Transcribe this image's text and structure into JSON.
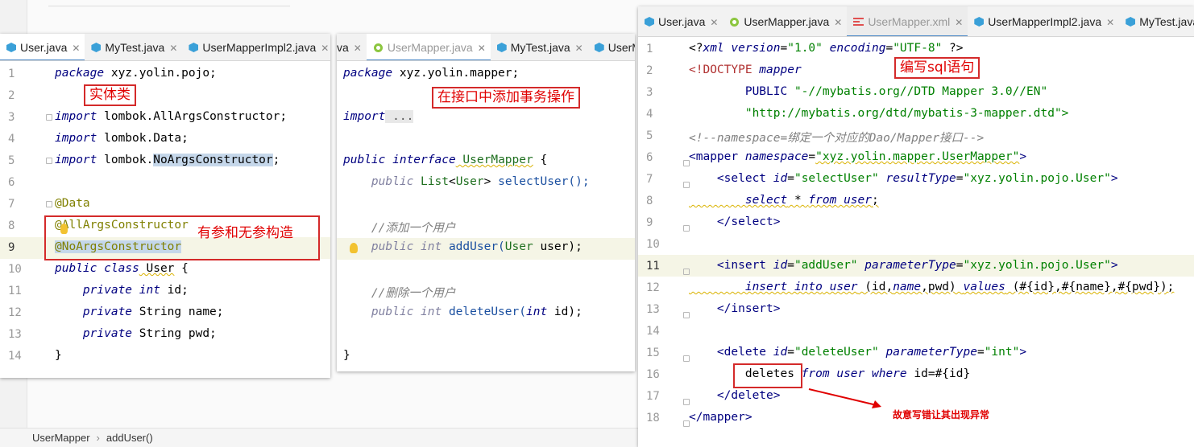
{
  "statusbar": {
    "crumb1": "UserMapper",
    "crumb2": "addUser()"
  },
  "panel1": {
    "tabs": [
      "User.java",
      "MyTest.java",
      "UserMapperImpl2.java"
    ],
    "lines": [
      "1",
      "2",
      "3",
      "4",
      "5",
      "6",
      "7",
      "8",
      "9",
      "10",
      "11",
      "12",
      "13",
      "14"
    ],
    "code": {
      "l1a": "package",
      "l1b": " xyz.yolin.pojo;",
      "l3a": "import",
      "l3b": " lombok.AllArgsConstructor;",
      "l4a": "import",
      "l4b": " lombok.Data;",
      "l5a": "import",
      "l5b": " lombok.",
      "l5c": "NoArgsConstructor",
      "l5d": ";",
      "l7": "@Data",
      "l8": "@AllArgsConstructor",
      "l9": "@NoArgsConstructor",
      "l10a": "public class",
      "l10b": " User",
      "l10c": " {",
      "l11a": "    private int",
      "l11b": " id;",
      "l12a": "    private",
      "l12b": " String",
      "l12c": " name;",
      "l13a": "    private",
      "l13b": " String",
      "l13c": " pwd;",
      "l14": "}"
    },
    "note_entity": "实体类",
    "note_ctor": "有参和无参构造"
  },
  "panel2": {
    "tabs": [
      "va",
      "UserMapper.java",
      "MyTest.java",
      "UserM"
    ],
    "code": {
      "l1a": "package",
      "l1b": " xyz.yolin.mapper;",
      "l3a": "import",
      "l3b": " ...",
      "l6a": "public interface",
      "l6b": " UserMapper",
      "l6c": " {",
      "l7a": "    public",
      "l7b": " List",
      "l7c": "<",
      "l7d": "User",
      "l7e": ">",
      "l7f": " selectUser();",
      "l9": "    //添加一个用户",
      "l10a": "    public int",
      "l10b": " addUser(",
      "l10c": "User",
      "l10d": " user);",
      "l12": "    //删除一个用户",
      "l13a": "    public int",
      "l13b": " deleteUser(",
      "l13c": "int",
      "l13d": " id);",
      "l15": "}"
    },
    "note_tx": "在接口中添加事务操作"
  },
  "panel3": {
    "tabs": [
      "User.java",
      "UserMapper.java",
      "UserMapper.xml",
      "UserMapperImpl2.java",
      "MyTest.java"
    ],
    "lines": [
      "1",
      "2",
      "3",
      "4",
      "5",
      "6",
      "7",
      "8",
      "9",
      "10",
      "11",
      "12",
      "13",
      "14",
      "15",
      "16",
      "17",
      "18"
    ],
    "code": {
      "l1a": "<?",
      "l1b": "xml version",
      "l1c": "=",
      "l1d": "\"1.0\"",
      "l1e": " encoding",
      "l1f": "=",
      "l1g": "\"UTF-8\"",
      "l1h": " ?>",
      "l2a": "<!DOCTYPE",
      "l2b": " mapper",
      "l3a": "        PUBLIC ",
      "l3b": "\"-//mybatis.org//DTD Mapper 3.0//EN\"",
      "l4": "        \"http://mybatis.org/dtd/mybatis-3-mapper.dtd\">",
      "l5": "<!--namespace=绑定一个对应的Dao/Mapper接口-->",
      "l6a": "<mapper",
      "l6b": " namespace",
      "l6c": "=",
      "l6d": "\"xyz.yolin.mapper.UserMapper\"",
      "l6e": ">",
      "l7a": "    <select",
      "l7b": " id",
      "l7c": "=",
      "l7d": "\"selectUser\"",
      "l7e": " resultType",
      "l7f": "=",
      "l7g": "\"xyz.yolin.pojo.User\"",
      "l7h": ">",
      "l8a": "        select",
      "l8b": " * ",
      "l8c": "from",
      "l8d": " user",
      "l8e": ";",
      "l9": "    </select>",
      "l11a": "    <insert",
      "l11b": " id",
      "l11c": "=",
      "l11d": "\"addUser\"",
      "l11e": " parameterType",
      "l11f": "=",
      "l11g": "\"xyz.yolin.pojo.User\"",
      "l11h": ">",
      "l12a": "        insert into",
      "l12b": " user",
      "l12c": " (id,",
      "l12d": "name",
      "l12e": ",pwd) ",
      "l12f": "values",
      "l12g": " (#{id},#{name},#{pwd});",
      "l13": "    </insert>",
      "l15a": "    <delete",
      "l15b": " id",
      "l15c": "=",
      "l15d": "\"deleteUser\"",
      "l15e": " parameterType",
      "l15f": "=",
      "l15g": "\"int\"",
      "l15h": ">",
      "l16a": "        deletes",
      "l16b": " from",
      "l16c": " user",
      "l16d": " where",
      "l16e": " id=#{id}",
      "l17": "    </delete>",
      "l18": "</mapper>"
    },
    "note_sql": "编写sql语句",
    "note_error": "故意写错让其出现异常"
  },
  "colors": {
    "accent": "#4a88c7",
    "annotation_red": "#e00000",
    "keyword": "#000080",
    "string": "#008000"
  }
}
